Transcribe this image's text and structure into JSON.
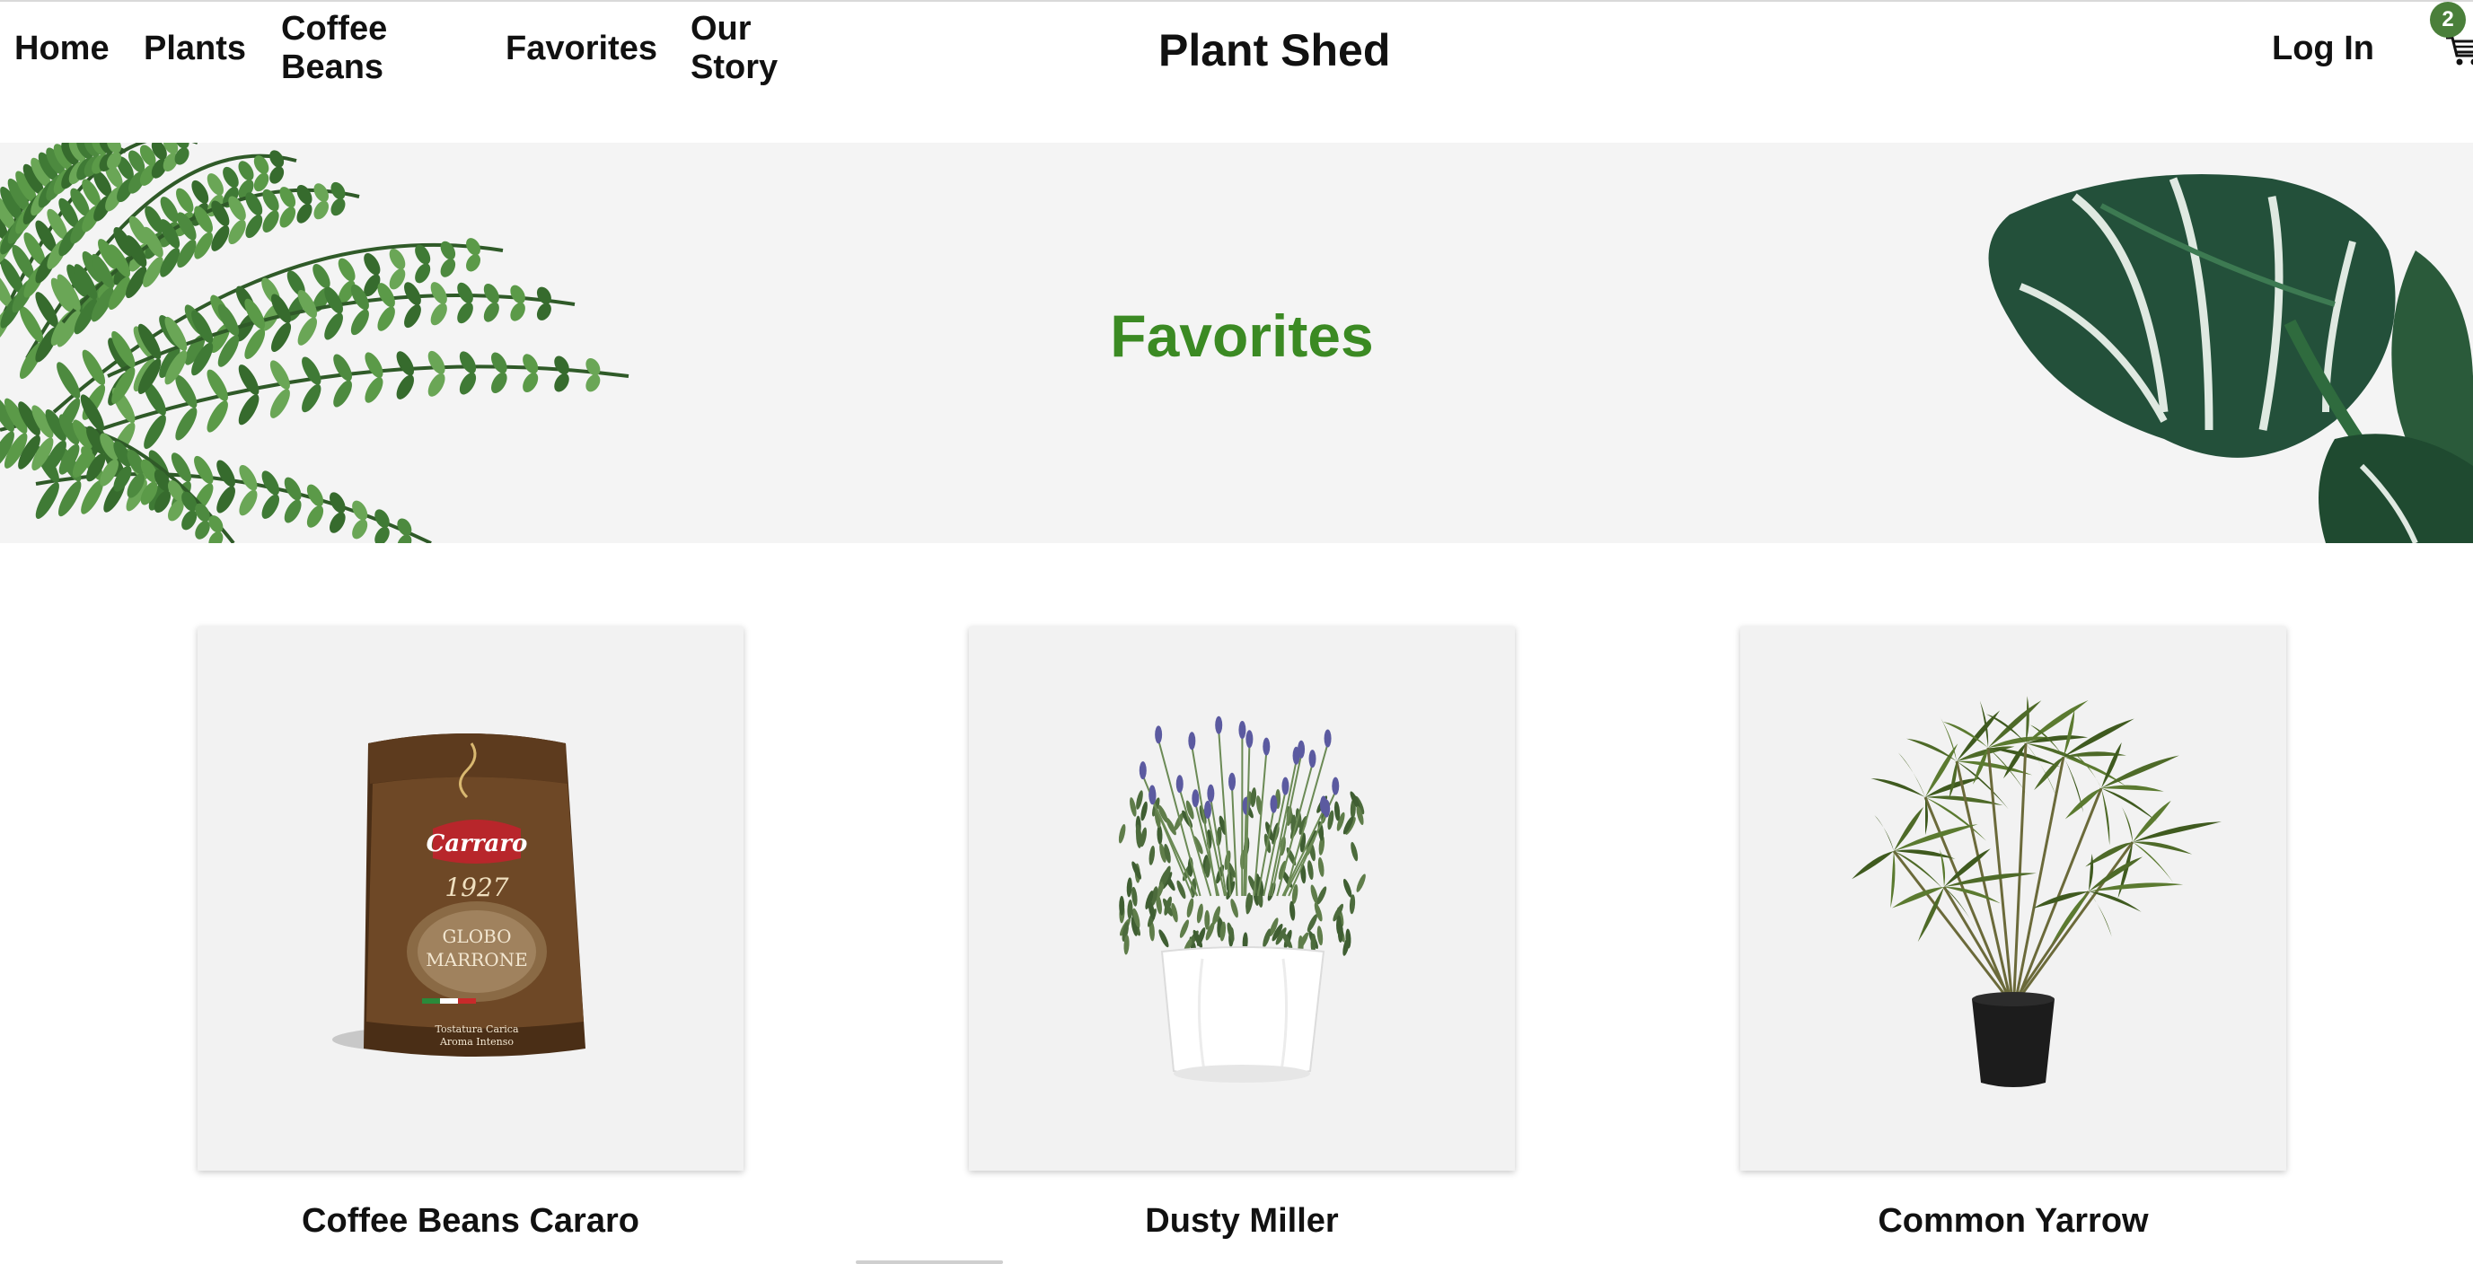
{
  "nav": {
    "home": "Home",
    "plants": "Plants",
    "coffee_line1": "Coffee",
    "coffee_line2": "Beans",
    "favorites": "Favorites",
    "story_line1": "Our",
    "story_line2": "Story"
  },
  "brand": "Plant Shed",
  "login": "Log In",
  "cart": {
    "icon": "cart-icon",
    "count": "2"
  },
  "hero": {
    "title": "Favorites"
  },
  "products": [
    {
      "name": "Coffee Beans Cararo",
      "image": "coffee-bag-image"
    },
    {
      "name": "Dusty Miller",
      "image": "potted-lavender-image"
    },
    {
      "name": "Common Yarrow",
      "image": "potted-palm-image"
    }
  ],
  "packaging": {
    "brand": "Carraro",
    "year": "1927",
    "line1": "GLOBO",
    "line2": "MARRONE",
    "note1": "Tostatura Carica",
    "note2": "Aroma Intenso"
  },
  "colors": {
    "accent_green": "#3b8a23",
    "badge_green": "#4a7f3a",
    "hero_background": "#f4f4f4",
    "card_background": "#f2f2f2"
  }
}
